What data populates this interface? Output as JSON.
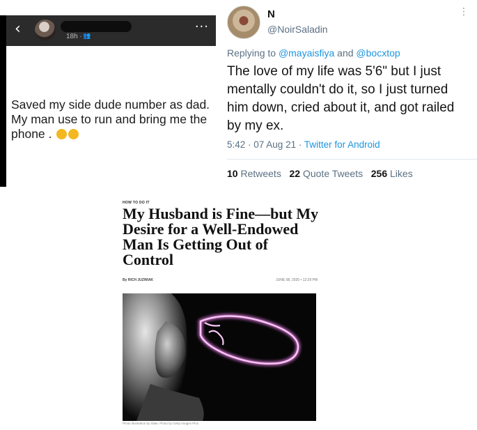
{
  "facebook_post": {
    "time": "18h ·",
    "post_text": "Saved my side dude number as dad. My man use to run and bring me the phone ."
  },
  "tweet": {
    "name": "N",
    "handle": "@NoirSaladin",
    "replying_prefix": "Replying to ",
    "reply_user_1": "@mayaisfiya",
    "reply_and": " and ",
    "reply_user_2": "@bocxtop",
    "body": "The love of my life was 5'6\" but I just mentally couldn't do it, so I just turned him down, cried about it, and got railed by my ex.",
    "timestamp": "5:42 · 07 Aug 21 · ",
    "source": "Twitter for Android",
    "retweets_count": "10",
    "retweets_label": " Retweets",
    "quote_count": "22",
    "quote_label": " Quote Tweets",
    "likes_count": "256",
    "likes_label": " Likes"
  },
  "article": {
    "kicker": "HOW TO DO IT",
    "title": "My Husband is Fine—but My Desire for a Well-Endowed Man Is Getting Out of Control",
    "byline": "By RICH JUZWIAK",
    "date": "JUNE 08, 2020 • 12:29 PM",
    "caption": "Photo illustration by Slate. Photo by Getty Images Plus."
  },
  "colors": {
    "twitter_link": "#1b95e0",
    "twitter_muted": "#5b7083",
    "neon_pink": "#e97ae6"
  }
}
